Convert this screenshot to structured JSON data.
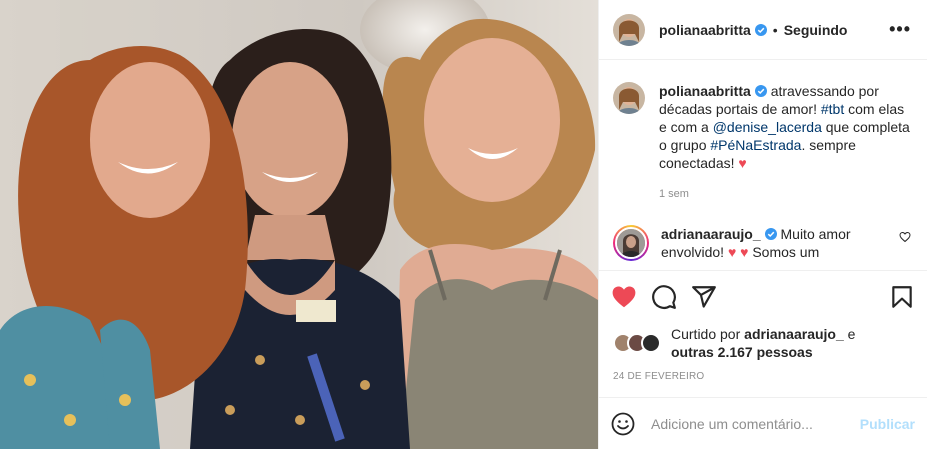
{
  "post": {
    "username": "polianaabritta",
    "verified_icon": "verified-badge-icon",
    "separator": "•",
    "follow_status": "Seguindo",
    "more_icon": "more-options-icon",
    "more_label": "•••"
  },
  "caption": {
    "username": "polianaabritta",
    "text_part1": "atravessando por décadas portais de amor! ",
    "hashtag1": "#tbt",
    "text_part2": " com elas e com a ",
    "mention": "@denise_lacerda",
    "text_part3": " que completa o grupo ",
    "hashtag2": "#PéNaEstrada",
    "text_part4": ". sempre conectadas! ",
    "heart": "♥",
    "time": "1 sem"
  },
  "comment": {
    "username": "adrianaaraujo_",
    "text": "Muito amor envolvido! ",
    "hearts": "♥ ♥",
    "text_tail": " Somos um"
  },
  "actions": {
    "like_icon": "heart-filled-icon",
    "comment_icon": "comment-icon",
    "share_icon": "share-icon",
    "save_icon": "bookmark-icon"
  },
  "likes": {
    "prefix": "Curtido por ",
    "user": "adrianaaraujo_",
    "mid": " e",
    "others": "outras 2.167 pessoas"
  },
  "date": "24 DE FEVEREIRO",
  "add_comment": {
    "emoji_icon": "emoji-icon",
    "placeholder": "Adicione um comentário...",
    "publish": "Publicar"
  },
  "colors": {
    "accent_red": "#ed4956",
    "link": "#00376b",
    "verified": "#3897f0",
    "publish_disabled": "#b2dffc",
    "muted": "#8e8e8e"
  }
}
